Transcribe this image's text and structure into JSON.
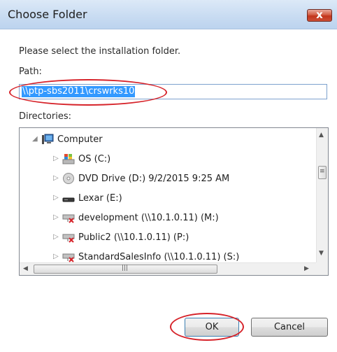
{
  "window": {
    "title": "Choose Folder",
    "close_label": "x"
  },
  "dialog": {
    "instruction": "Please select the installation folder.",
    "path_label": "Path:",
    "path_value": "\\\\ptp-sbs2011\\crswrks10",
    "directories_label": "Directories:"
  },
  "tree": {
    "items": [
      {
        "label": "Computer",
        "icon": "computer-icon",
        "expander": "expanded"
      },
      {
        "label": "OS (C:)",
        "icon": "windows-drive-icon",
        "expander": "collapsed"
      },
      {
        "label": "DVD Drive (D:) 9/2/2015 9:25 AM",
        "icon": "dvd-drive-icon",
        "expander": "collapsed"
      },
      {
        "label": "Lexar (E:)",
        "icon": "removable-drive-icon",
        "expander": "collapsed"
      },
      {
        "label": "development (\\\\10.1.0.11) (M:)",
        "icon": "disconnected-network-drive-icon",
        "expander": "collapsed"
      },
      {
        "label": "Public2 (\\\\10.1.0.11) (P:)",
        "icon": "disconnected-network-drive-icon",
        "expander": "collapsed"
      },
      {
        "label": "StandardSalesInfo (\\\\10.1.0.11) (S:)",
        "icon": "disconnected-network-drive-icon",
        "expander": "collapsed"
      }
    ]
  },
  "buttons": {
    "ok_label": "OK",
    "cancel_label": "Cancel"
  },
  "colors": {
    "selection": "#3399ff",
    "highlight_oval": "#d6232a",
    "title_bar": "#c9dcf2",
    "close_button": "#c2351c"
  }
}
